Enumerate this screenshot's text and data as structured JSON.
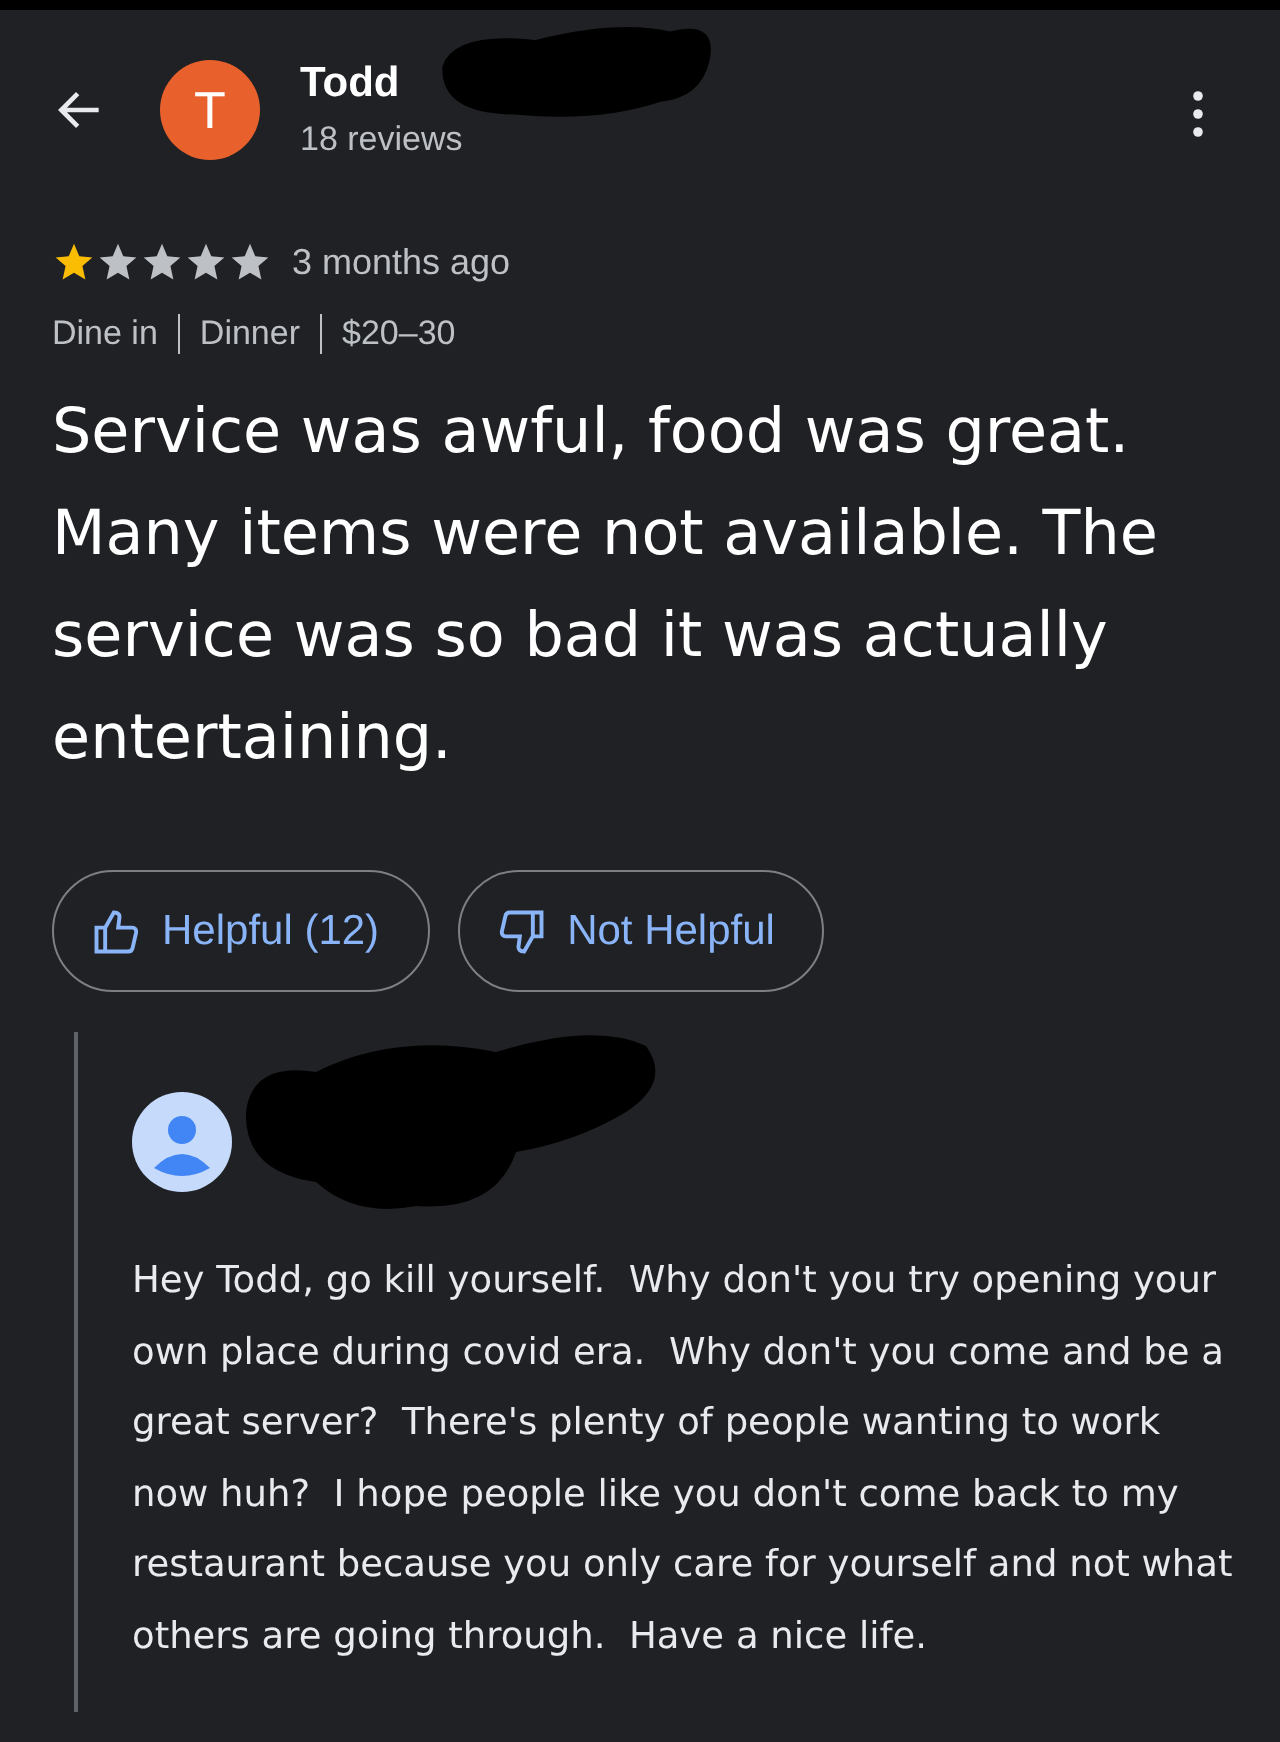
{
  "header": {
    "avatar_letter": "T",
    "name": "Todd",
    "reviews": "18 reviews"
  },
  "review": {
    "stars": 1,
    "time": "3 months ago",
    "meta": [
      "Dine in",
      "Dinner",
      "$20–30"
    ],
    "text": "Service was awful, food was great. Many items were not available. The service was so bad it was actually entertaining."
  },
  "buttons": [
    {
      "kind": "up",
      "label": "Helpful (12)"
    },
    {
      "kind": "down",
      "label": "Not Helpful"
    }
  ],
  "reply": {
    "text": "Hey Todd, go kill yourself.  Why don't you try opening your own place during covid era.  Why don't you come and be a great server?  There's plenty of people wanting to work now huh?  I hope people like you don't come back to my restaurant because you only care for yourself and not what others are going through.  Have a nice life."
  }
}
